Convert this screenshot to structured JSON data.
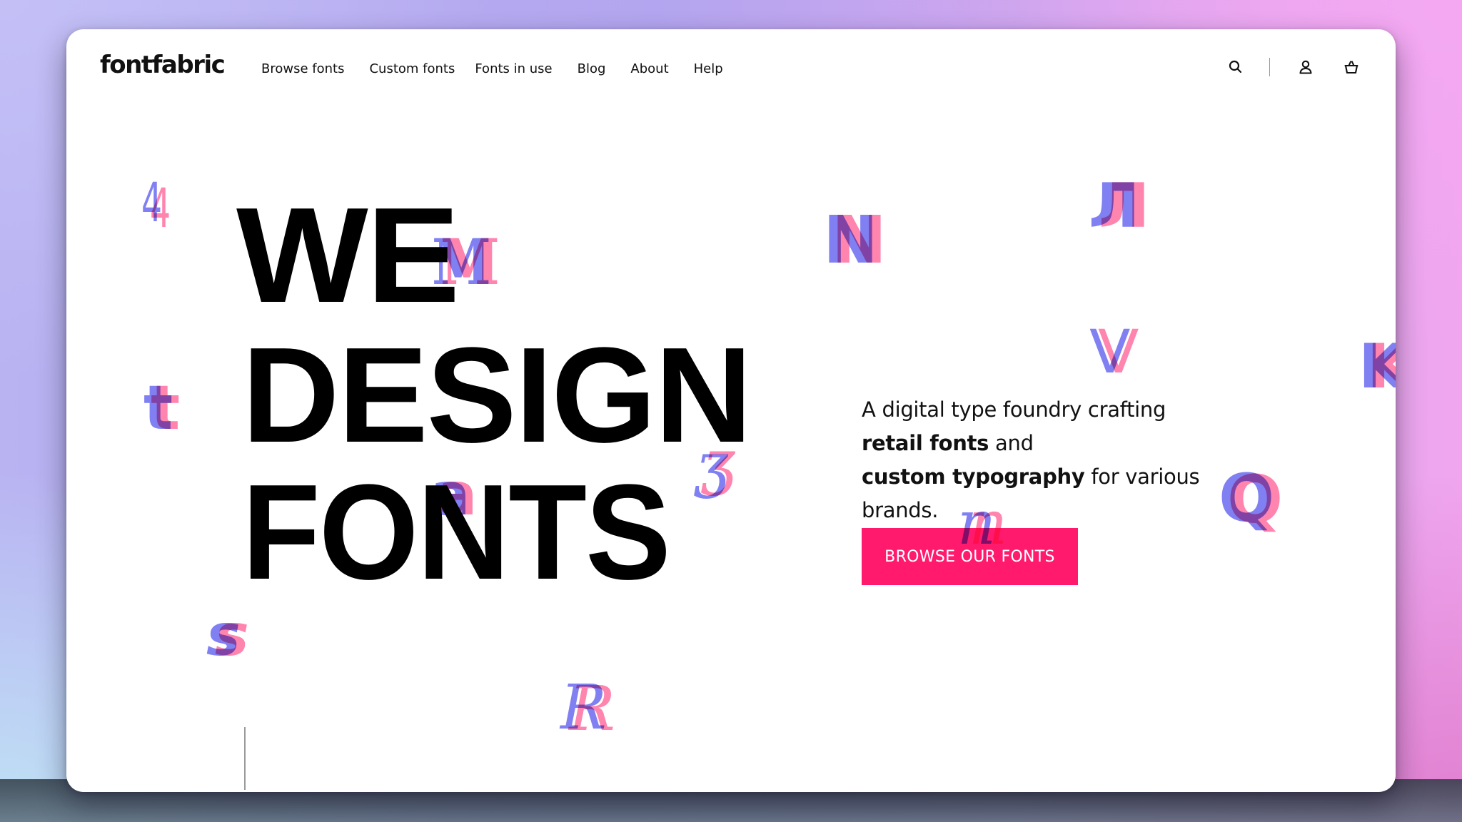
{
  "brand": {
    "logo": "fontfabric",
    "accent_color": "#ff1a6e",
    "glyph_colors": {
      "blue": "#6e6ef0",
      "pink": "#ff6ea0"
    }
  },
  "nav": {
    "items": [
      {
        "label": "Browse fonts"
      },
      {
        "label": "Custom fonts"
      },
      {
        "label": "Fonts in use"
      },
      {
        "label": "Blog"
      },
      {
        "label": "About"
      },
      {
        "label": "Help"
      }
    ]
  },
  "header_icons": {
    "search": "search-icon",
    "account": "user-icon",
    "cart": "basket-icon"
  },
  "hero": {
    "line1": "WE",
    "line2": "DESIGN",
    "line3": "FONTS",
    "tagline": {
      "part1": "A digital type foundry crafting",
      "bold1": "retail fonts",
      "part2": " and",
      "bold2": "custom typography",
      "part3": " for various brands."
    },
    "cta_label": "BROWSE OUR FONTS"
  },
  "decorative_glyphs": [
    "4",
    "M",
    "N",
    "Л",
    "V",
    "K",
    "t",
    "ʒ",
    "a",
    "Q",
    "n",
    "s",
    "R"
  ]
}
